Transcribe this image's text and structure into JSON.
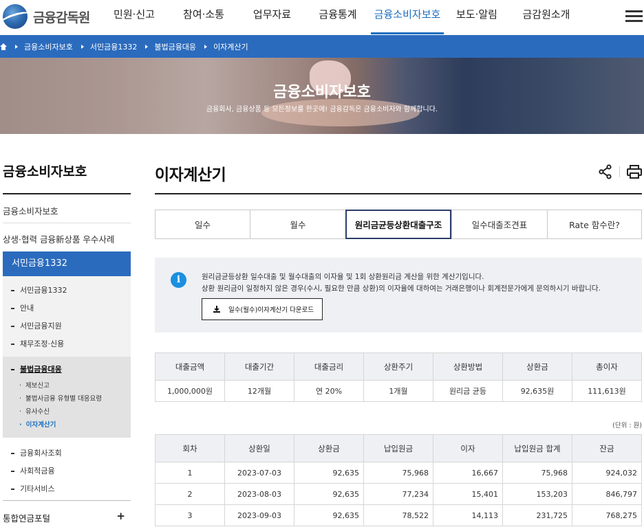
{
  "header": {
    "logo_text": "금융감독원",
    "menu": [
      {
        "label": "민원·신고"
      },
      {
        "label": "참여·소통"
      },
      {
        "label": "업무자료"
      },
      {
        "label": "금융통계"
      },
      {
        "label": "금융소비자보호",
        "active": true
      },
      {
        "label": "보도·알림"
      },
      {
        "label": "금감원소개"
      }
    ]
  },
  "breadcrumb": [
    "금융소비자보호",
    "서민금융1332",
    "불법금융대응",
    "이자계산기"
  ],
  "hero": {
    "title": "금융소비자보호",
    "subtitle": "금융회사, 금융상품 등 모든정보를 한곳에! 금융감독은 금융소비자와 함께합니다."
  },
  "sidebar": {
    "title": "금융소비자보호",
    "links": [
      "금융소비자보호",
      "상생·협력 금융新상품 우수사례"
    ],
    "active_section": "서민금융1332",
    "sub_items": [
      "서민금융1332",
      "안내",
      "서민금융지원",
      "채무조정·신용"
    ],
    "current_group": "불법금융대응",
    "current_group_items": [
      "제보신고",
      "불법사금융 유형별 대응요령",
      "유사수신",
      "이자계산기"
    ],
    "more_items": [
      "금융회사조회",
      "사회적금융",
      "기타서비스"
    ],
    "last_link": "통합연금포털",
    "last_link_icon": "+"
  },
  "main": {
    "title": "이자계산기",
    "tabs": [
      "일수",
      "월수",
      "원리금균등상환대출구조",
      "일수대출조견표",
      "Rate 함수란?"
    ],
    "active_tab": 2,
    "info_lines": [
      "원리금균등상환 일수대출 및 월수대출의 이자율 및 1회 상환원리금 계산을 위한 계산기입니다.",
      "상환 원리금이 일정하지 않은 경우(수시, 필요한 만큼 상환)의 이자율에 대하여는 거래은행이나 회계전문가에게 문의하시기 바랍니다."
    ],
    "download_label": "일수(월수)이자계산기 다운로드",
    "summary_headers": [
      "대출금액",
      "대출기간",
      "대출금리",
      "상환주기",
      "상환방법",
      "상환금",
      "총이자"
    ],
    "summary_values": [
      "1,000,000원",
      "12개월",
      "연 20%",
      "1개월",
      "원리금 균등",
      "92,635원",
      "111,613원"
    ],
    "unit": "(단위 : 원)",
    "schedule_headers": [
      "회차",
      "상환일",
      "상환금",
      "납입원금",
      "이자",
      "납입원금 합계",
      "잔금"
    ],
    "schedule_rows": [
      [
        "1",
        "2023-07-03",
        "92,635",
        "75,968",
        "16,667",
        "75,968",
        "924,032"
      ],
      [
        "2",
        "2023-08-03",
        "92,635",
        "77,234",
        "15,401",
        "153,203",
        "846,797"
      ],
      [
        "3",
        "2023-09-03",
        "92,635",
        "78,522",
        "14,113",
        "231,725",
        "768,275"
      ]
    ]
  }
}
